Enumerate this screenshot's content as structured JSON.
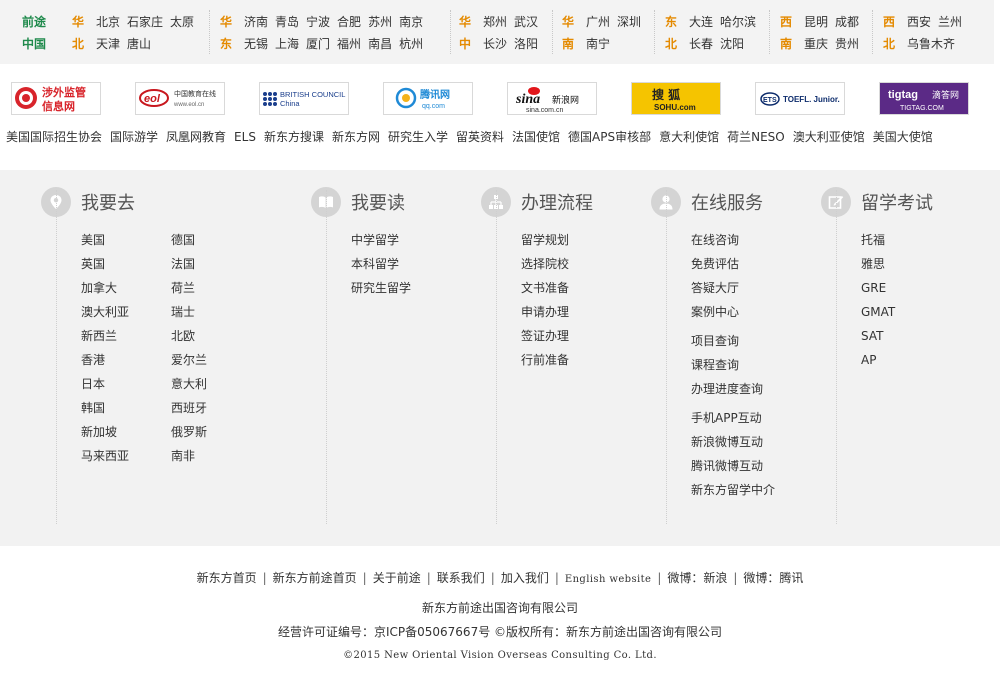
{
  "regions": {
    "brand": [
      "前途",
      "中国"
    ],
    "groups": [
      {
        "tags": [
          "华",
          "北"
        ],
        "rows": [
          [
            "北京",
            "石家庄",
            "太原"
          ],
          [
            "天津",
            "唐山"
          ]
        ]
      },
      {
        "tags": [
          "华",
          "东"
        ],
        "rows": [
          [
            "济南",
            "青岛",
            "宁波",
            "合肥",
            "苏州",
            "南京"
          ],
          [
            "无锡",
            "上海",
            "厦门",
            "福州",
            "南昌",
            "杭州"
          ]
        ]
      },
      {
        "tags": [
          "华",
          "中"
        ],
        "rows": [
          [
            "郑州",
            "武汉"
          ],
          [
            "长沙",
            "洛阳"
          ]
        ]
      },
      {
        "tags": [
          "华",
          "南"
        ],
        "rows": [
          [
            "广州",
            "深圳"
          ],
          [
            "南宁"
          ]
        ]
      },
      {
        "tags": [
          "东",
          "北"
        ],
        "rows": [
          [
            "大连",
            "哈尔滨"
          ],
          [
            "长春",
            "沈阳"
          ]
        ]
      },
      {
        "tags": [
          "西",
          "南"
        ],
        "rows": [
          [
            "昆明",
            "成都"
          ],
          [
            "重庆",
            "贵州"
          ]
        ]
      },
      {
        "tags": [
          "西",
          "北"
        ],
        "rows": [
          [
            "西安",
            "兰州"
          ],
          [
            "乌鲁木齐"
          ]
        ]
      }
    ]
  },
  "logos": [
    {
      "name": "涉外监管信息网",
      "icon": "shield-flag-icon",
      "color": "#d8242b"
    },
    {
      "name": "中国教育在线 www.eol.cn",
      "icon": "eol-logo",
      "color": "#c8171e"
    },
    {
      "name": "BRITISH COUNCIL China",
      "icon": "british-council-dots",
      "color": "#1a3e8c"
    },
    {
      "name": "腾讯网 qq.com",
      "icon": "tencent-logo",
      "color": "#1f8ad6"
    },
    {
      "name": "sina新浪网 sina.com.cn",
      "icon": "sina-eye-logo",
      "color": "#e2161b"
    },
    {
      "name": "搜狐 SOHU.com",
      "icon": "sohu-fox-logo",
      "color": "#f5c400"
    },
    {
      "name": "ETS TOEFL Junior",
      "icon": "ets-logo",
      "color": "#0d2c6c"
    },
    {
      "name": "tigtag 滴答网 TIGTAG.COM",
      "icon": "tigtag-logo",
      "color": "#5b2a86"
    }
  ],
  "partner_links": [
    "美国国际招生协会",
    "国际游学",
    "凤凰网教育",
    "ELS",
    "新东方搜课",
    "新东方网",
    "研究生入学",
    "留英资料",
    "法国使馆",
    "德国APS审核部",
    "意大利使馆",
    "荷兰NESO",
    "澳大利亚使馆",
    "美国大使馆"
  ],
  "nav": {
    "columns": [
      {
        "title": "我要去",
        "icon": "location-pin-icon",
        "items": [
          "美国",
          "英国",
          "加拿大",
          "澳大利亚",
          "新西兰",
          "香港",
          "日本",
          "韩国",
          "新加坡",
          "马来西亚"
        ],
        "items2": [
          "德国",
          "法国",
          "荷兰",
          "瑞士",
          "北欧",
          "爱尔兰",
          "意大利",
          "西班牙",
          "俄罗斯",
          "南非"
        ]
      },
      {
        "title": "我要读",
        "icon": "open-book-icon",
        "items": [
          "中学留学",
          "本科留学",
          "研究生留学"
        ]
      },
      {
        "title": "办理流程",
        "icon": "flowchart-icon",
        "items": [
          "留学规划",
          "选择院校",
          "文书准备",
          "申请办理",
          "签证办理",
          "行前准备"
        ]
      },
      {
        "title": "在线服务",
        "icon": "user-icon",
        "items": [
          "在线咨询",
          "免费评估",
          "答疑大厅",
          "案例中心"
        ],
        "items_b": [
          "项目查询",
          "课程查询",
          "办理进度查询"
        ],
        "items_c": [
          "手机APP互动",
          "新浪微博互动",
          "腾讯微博互动",
          "新东方留学中介"
        ]
      },
      {
        "title": "留学考试",
        "icon": "edit-icon",
        "items": [
          "托福",
          "雅思",
          "GRE",
          "GMAT",
          "SAT",
          "AP"
        ]
      }
    ]
  },
  "footer": {
    "links": [
      "新东方首页",
      "新东方前途首页",
      "关于前途",
      "联系我们",
      "加入我们",
      "English website",
      "微博：新浪",
      "微博：腾讯"
    ],
    "company": "新东方前途出国咨询有限公司",
    "license": "经营许可证编号：京ICP备05067667号 ©版权所有：新东方前途出国咨询有限公司",
    "copyright": "©2015 New Oriental Vision Overseas Consulting Co. Ltd."
  }
}
